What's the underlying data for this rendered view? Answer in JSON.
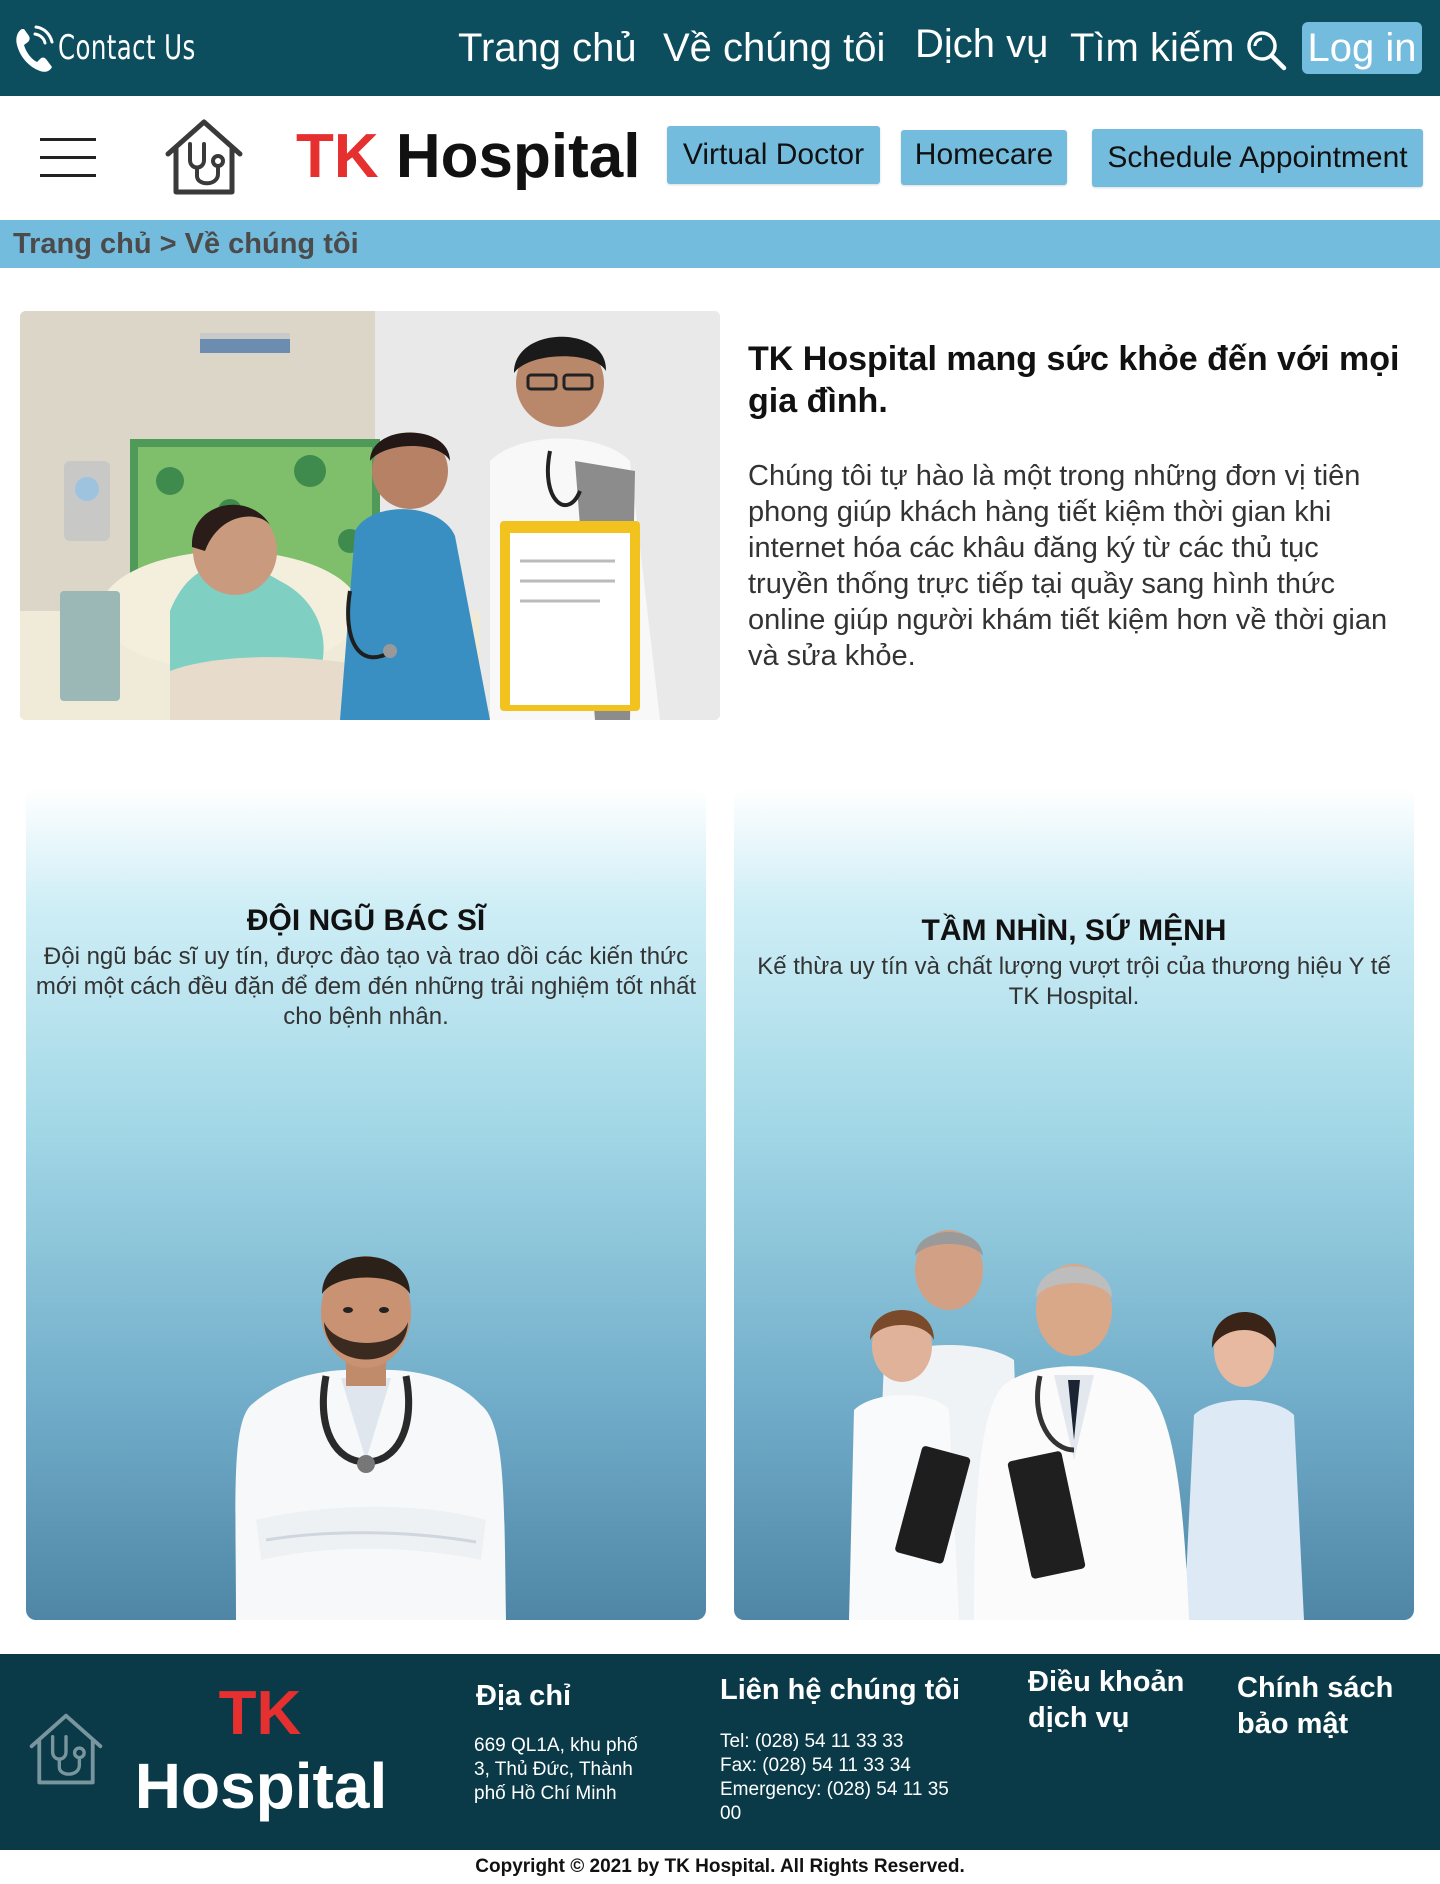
{
  "topbar": {
    "contact_label": "Contact Us",
    "nav": [
      "Trang chủ",
      "Về chúng tôi",
      "Dịch vụ",
      "Tìm kiếm"
    ],
    "login_label": "Log in",
    "background": "#0c4d5e"
  },
  "header": {
    "brand_tk": "TK",
    "brand_rest": "Hospital",
    "buttons": [
      "Virtual Doctor",
      "Homecare",
      "Schedule Appointment"
    ],
    "accent": "#74bcde",
    "brand_color": "#e63030"
  },
  "breadcrumb": {
    "text": "Trang chủ > Về chúng tôi"
  },
  "hero": {
    "title": "TK Hospital mang sức khỏe đến với mọi gia đình.",
    "text": "Chúng tôi tự hào là một trong những đơn vị tiên phong giúp khách hàng tiết kiệm thời gian khi internet hóa các khâu đăng ký từ các thủ tục truyền thống trực tiếp tại quầy sang hình thức online giúp người khám tiết kiệm hơn về thời gian và sửa khỏe."
  },
  "cards": [
    {
      "title": "ĐỘI NGŨ BÁC SĨ",
      "text": "Đội ngũ bác sĩ uy tín, được đào tạo và trao dồi các kiến thức mới một cách đều đặn để đem đén những trải nghiệm tốt nhất cho bệnh nhân."
    },
    {
      "title": "TẦM NHÌN, SỨ MỆNH",
      "text": "Kế thừa uy tín và chất lượng vượt trội của thương hiệu Y tế TK Hospital."
    }
  ],
  "footer": {
    "brand_tk": "TK",
    "brand_rest": "Hospital",
    "address_heading": "Địa chỉ",
    "address": [
      "669 QL1A, khu phố",
      "3, Thủ Đức, Thành",
      "phố Hồ Chí Minh"
    ],
    "contact_heading": "Liên hệ chúng tôi",
    "contact": [
      "Tel: (028) 54 11 33 33",
      "Fax: (028) 54 11 33 34",
      "Emergency: (028) 54 11 35",
      "00"
    ],
    "terms": [
      "Điều khoản",
      "dịch vụ"
    ],
    "privacy": [
      "Chính sách",
      "bảo mật"
    ],
    "background": "#0a3a48"
  },
  "copyright": "Copyright © 2021 by TK Hospital. All Rights Reserved."
}
